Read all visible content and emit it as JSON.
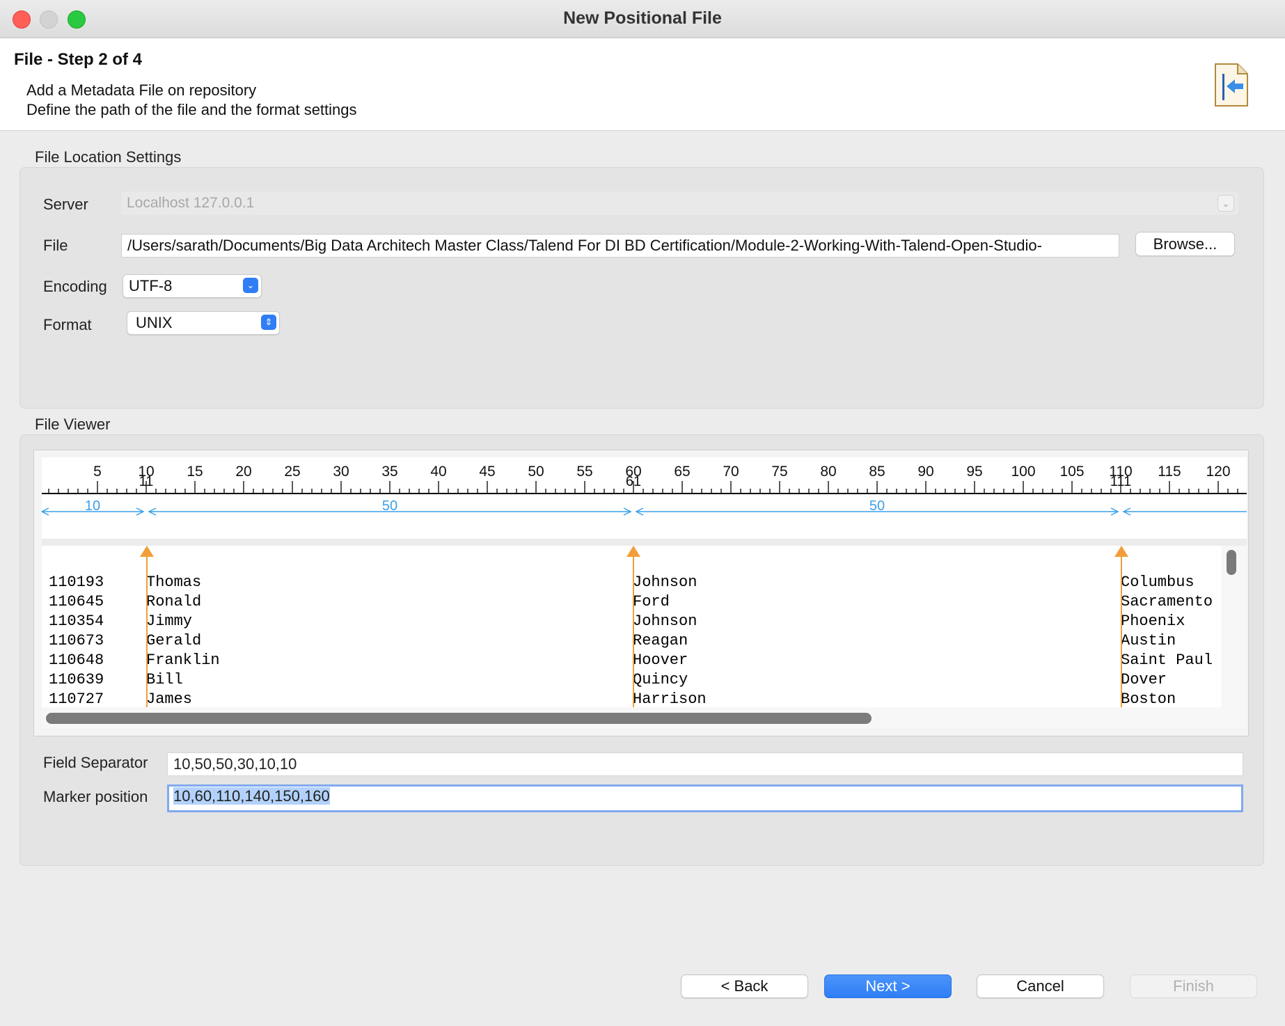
{
  "window": {
    "title": "New Positional File"
  },
  "header": {
    "step_title": "File - Step 2 of 4",
    "description_line1": "Add a Metadata File on repository",
    "description_line2": "Define the path of the file and the format settings"
  },
  "file_location": {
    "group_label": "File Location Settings",
    "server_label": "Server",
    "server_value": "Localhost 127.0.0.1",
    "file_label": "File",
    "file_value": "/Users/sarath/Documents/Big Data Architech Master Class/Talend For DI BD Certification/Module-2-Working-With-Talend-Open-Studio-",
    "browse_label": "Browse...",
    "encoding_label": "Encoding",
    "encoding_value": "UTF-8",
    "format_label": "Format",
    "format_value": "UNIX"
  },
  "file_viewer": {
    "group_label": "File Viewer",
    "ruler_ticks": [
      "5",
      "10",
      "15",
      "20",
      "25",
      "30",
      "35",
      "40",
      "45",
      "50",
      "55",
      "60",
      "65",
      "70",
      "75",
      "80",
      "85",
      "90",
      "95",
      "100",
      "105",
      "110",
      "115",
      "120"
    ],
    "marker_labels": [
      "11",
      "61",
      "111"
    ],
    "field_widths": [
      "10",
      "50",
      "50"
    ],
    "rows": [
      {
        "id": "110193",
        "first": "Thomas",
        "last": "Johnson",
        "city": "Columbus"
      },
      {
        "id": "110645",
        "first": "Ronald",
        "last": "Ford",
        "city": "Sacramento"
      },
      {
        "id": "110354",
        "first": "Jimmy",
        "last": "Johnson",
        "city": "Phoenix"
      },
      {
        "id": "110673",
        "first": "Gerald",
        "last": "Reagan",
        "city": "Austin"
      },
      {
        "id": "110648",
        "first": "Franklin",
        "last": "Hoover",
        "city": "Saint Paul"
      },
      {
        "id": "110639",
        "first": "Bill",
        "last": "Quincy",
        "city": "Dover"
      },
      {
        "id": "110727",
        "first": "James",
        "last": "Harrison",
        "city": "Boston"
      }
    ]
  },
  "separator": {
    "field_separator_label": "Field Separator",
    "field_separator_value": "10,50,50,30,10,10",
    "marker_position_label": "Marker position",
    "marker_position_value": "10,60,110,140,150,160"
  },
  "buttons": {
    "back": "< Back",
    "next": "Next >",
    "cancel": "Cancel",
    "finish": "Finish"
  },
  "colors": {
    "accent": "#2f7ef5",
    "marker": "#f19e3a",
    "ruler_measure": "#3aa0e8"
  }
}
